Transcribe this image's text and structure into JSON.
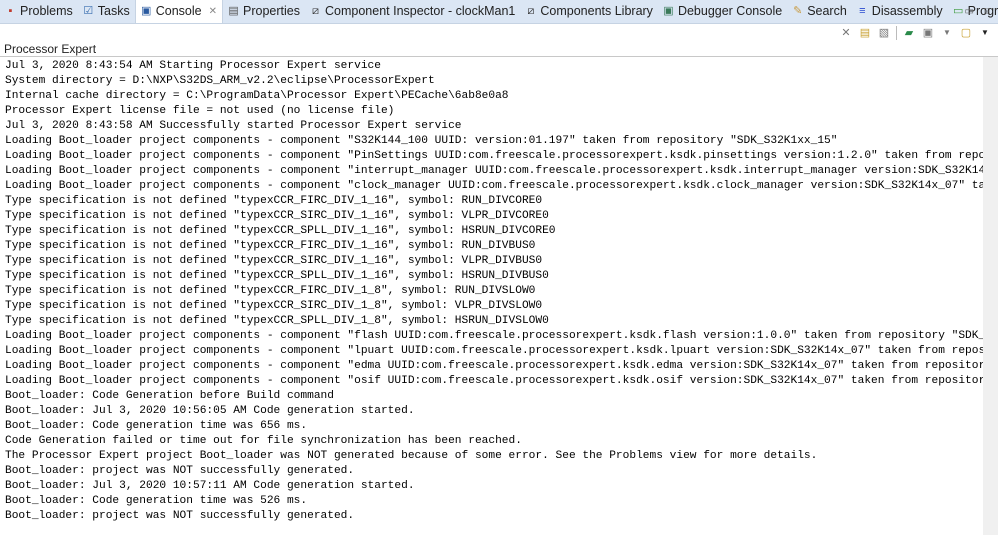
{
  "tabs": [
    {
      "label": "Problems",
      "icon": "problems-icon",
      "glyph": "▪",
      "color": "#c0392b"
    },
    {
      "label": "Tasks",
      "icon": "tasks-icon",
      "glyph": "☑",
      "color": "#3a6fb0"
    },
    {
      "label": "Console",
      "icon": "console-icon",
      "glyph": "▣",
      "color": "#2a5aa0",
      "active": true
    },
    {
      "label": "Properties",
      "icon": "properties-icon",
      "glyph": "▤",
      "color": "#555"
    },
    {
      "label": "Component Inspector - clockMan1",
      "icon": "component-icon",
      "glyph": "⧄",
      "color": "#333"
    },
    {
      "label": "Components Library",
      "icon": "component-icon",
      "glyph": "⧄",
      "color": "#333"
    },
    {
      "label": "Debugger Console",
      "icon": "debugger-console-icon",
      "glyph": "▣",
      "color": "#3a7a5a"
    },
    {
      "label": "Search",
      "icon": "search-icon",
      "glyph": "✎",
      "color": "#c89a40"
    },
    {
      "label": "Disassembly",
      "icon": "disassembly-icon",
      "glyph": "≡",
      "color": "#2a4ad0"
    },
    {
      "label": "Progress",
      "icon": "progress-icon",
      "glyph": "▭",
      "color": "#3a9a3a"
    }
  ],
  "view_title": "Processor Expert",
  "console_lines": [
    "Jul 3, 2020 8:43:54 AM Starting Processor Expert service",
    "System directory = D:\\NXP\\S32DS_ARM_v2.2\\eclipse\\ProcessorExpert",
    "Internal cache directory = C:\\ProgramData\\Processor Expert\\PECache\\6ab8e0a8",
    "Processor Expert license file = not used (no license file)",
    "Jul 3, 2020 8:43:58 AM Successfully started Processor Expert service",
    "Loading Boot_loader project components - component \"S32K144_100 UUID: version:01.197\" taken from repository \"SDK_S32K1xx_15\"",
    "Loading Boot_loader project components - component \"PinSettings UUID:com.freescale.processorexpert.ksdk.pinsettings version:1.2.0\" taken from repo",
    "Loading Boot_loader project components - component \"interrupt_manager UUID:com.freescale.processorexpert.ksdk.interrupt_manager version:SDK_S32K14",
    "Loading Boot_loader project components - component \"clock_manager UUID:com.freescale.processorexpert.ksdk.clock_manager version:SDK_S32K14x_07\" ta",
    "Type specification is not defined \"typexCCR_FIRC_DIV_1_16\", symbol: RUN_DIVCORE0",
    "Type specification is not defined \"typexCCR_SIRC_DIV_1_16\", symbol: VLPR_DIVCORE0",
    "Type specification is not defined \"typexCCR_SPLL_DIV_1_16\", symbol: HSRUN_DIVCORE0",
    "Type specification is not defined \"typexCCR_FIRC_DIV_1_16\", symbol: RUN_DIVBUS0",
    "Type specification is not defined \"typexCCR_SIRC_DIV_1_16\", symbol: VLPR_DIVBUS0",
    "Type specification is not defined \"typexCCR_SPLL_DIV_1_16\", symbol: HSRUN_DIVBUS0",
    "Type specification is not defined \"typexCCR_FIRC_DIV_1_8\", symbol: RUN_DIVSLOW0",
    "Type specification is not defined \"typexCCR_SIRC_DIV_1_8\", symbol: VLPR_DIVSLOW0",
    "Type specification is not defined \"typexCCR_SPLL_DIV_1_8\", symbol: HSRUN_DIVSLOW0",
    "Loading Boot_loader project components - component \"flash UUID:com.freescale.processorexpert.ksdk.flash version:1.0.0\" taken from repository \"SDK_",
    "Loading Boot_loader project components - component \"lpuart UUID:com.freescale.processorexpert.ksdk.lpuart version:SDK_S32K14x_07\" taken from repos",
    "Loading Boot_loader project components - component \"edma UUID:com.freescale.processorexpert.ksdk.edma version:SDK_S32K14x_07\" taken from repositor",
    "Loading Boot_loader project components - component \"osif UUID:com.freescale.processorexpert.ksdk.osif version:SDK_S32K14x_07\" taken from repositor",
    "Boot_loader: Code Generation before Build command",
    "Boot_loader: Jul 3, 2020 10:56:05 AM Code generation started.",
    "Boot_loader: Code generation time was 656 ms.",
    "Code Generation failed or time out for file synchronization has been reached.",
    "The Processor Expert project Boot_loader was NOT generated because of some error. See the Problems view for more details.",
    "Boot_loader: project was NOT successfully generated.",
    "Boot_loader: Jul 3, 2020 10:57:11 AM Code generation started.",
    "Boot_loader: Code generation time was 526 ms.",
    "Boot_loader: project was NOT successfully generated."
  ]
}
